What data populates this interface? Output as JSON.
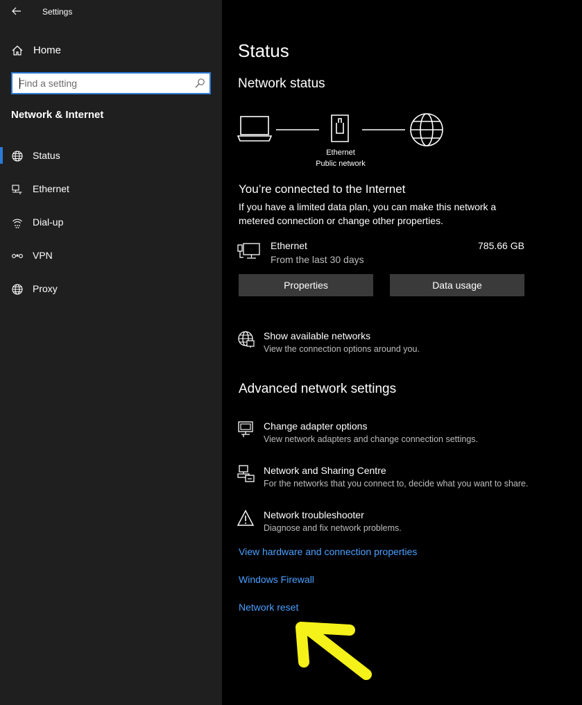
{
  "window": {
    "title": "Settings"
  },
  "sidebar": {
    "home_label": "Home",
    "search_placeholder": "Find a setting",
    "section_title": "Network & Internet",
    "items": [
      {
        "label": "Status",
        "icon": "globe-icon",
        "selected": true
      },
      {
        "label": "Ethernet",
        "icon": "ethernet-icon",
        "selected": false
      },
      {
        "label": "Dial-up",
        "icon": "dial-up-icon",
        "selected": false
      },
      {
        "label": "VPN",
        "icon": "vpn-icon",
        "selected": false
      },
      {
        "label": "Proxy",
        "icon": "globe-icon",
        "selected": false
      }
    ],
    "accent_color": "#2c7ad6"
  },
  "main": {
    "title": "Status",
    "network_status_heading": "Network status",
    "diagram": {
      "adapter_name": "Ethernet",
      "network_type": "Public network"
    },
    "connected_heading": "You’re connected to the Internet",
    "connected_desc": "If you have a limited data plan, you can make this network a metered connection or change other properties.",
    "connection": {
      "name": "Ethernet",
      "period": "From the last 30 days",
      "usage": "785.66 GB"
    },
    "buttons": {
      "properties": "Properties",
      "data_usage": "Data usage"
    },
    "show_networks": {
      "title": "Show available networks",
      "desc": "View the connection options around you."
    },
    "advanced_heading": "Advanced network settings",
    "advanced_items": [
      {
        "title": "Change adapter options",
        "desc": "View network adapters and change connection settings.",
        "icon": "adapter-icon"
      },
      {
        "title": "Network and Sharing Centre",
        "desc": "For the networks that you connect to, decide what you want to share.",
        "icon": "sharing-icon"
      },
      {
        "title": "Network troubleshooter",
        "desc": "Diagnose and fix network problems.",
        "icon": "warning-icon"
      }
    ],
    "links": [
      "View hardware and connection properties",
      "Windows Firewall",
      "Network reset"
    ],
    "link_color": "#4aa0ff",
    "annotation_color": "#f5f21a"
  }
}
